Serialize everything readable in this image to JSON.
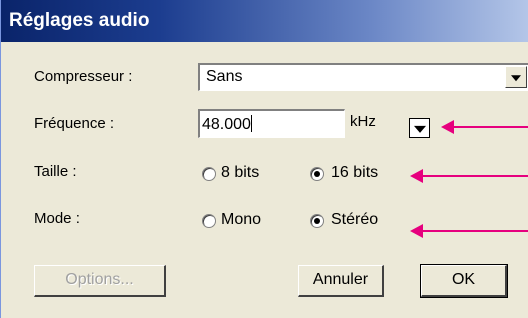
{
  "dialog": {
    "title": "Réglages audio"
  },
  "compressor": {
    "label": "Compresseur :",
    "value": "Sans"
  },
  "frequency": {
    "label": "Fréquence :",
    "value": "48.000",
    "unit": "kHz"
  },
  "size": {
    "label": "Taille :",
    "options": [
      "8 bits",
      "16 bits"
    ],
    "selected": "16 bits"
  },
  "mode": {
    "label": "Mode :",
    "options": [
      "Mono",
      "Stéréo"
    ],
    "selected": "Stéréo"
  },
  "buttons": {
    "options": "Options...",
    "cancel": "Annuler",
    "ok": "OK"
  },
  "colors": {
    "titlebar": "#0a246a",
    "dialog_bg": "#ece9d8",
    "annotation_arrow": "#e6007e"
  }
}
